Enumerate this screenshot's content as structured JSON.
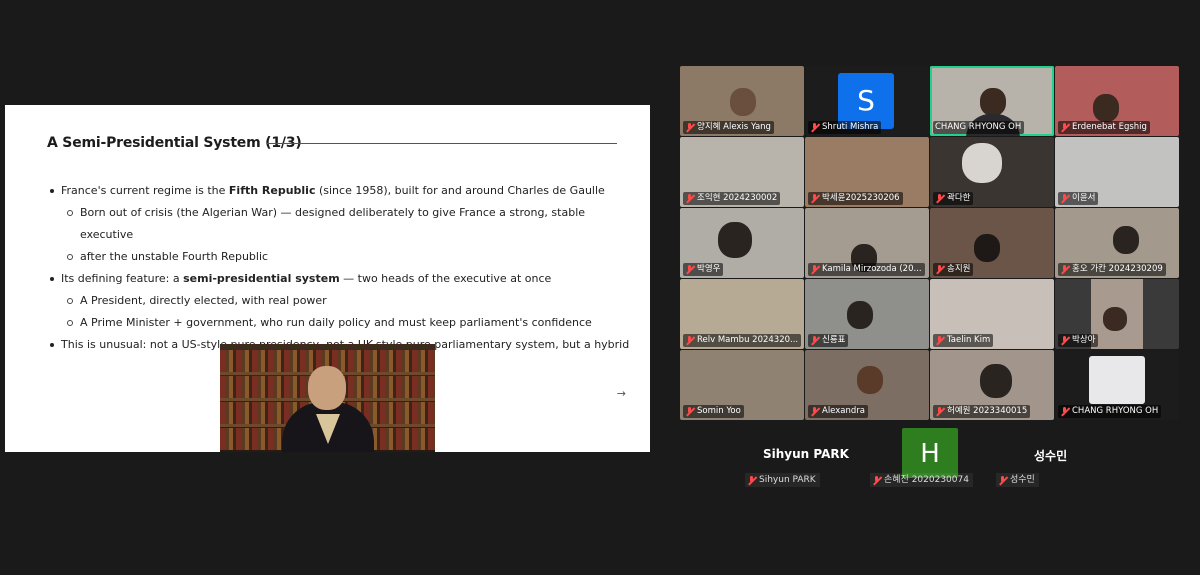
{
  "slide": {
    "title": "A Semi-Presidential System (1/3)",
    "bullets": [
      {
        "level": 1,
        "pre": "France's current regime is the ",
        "bold": "Fifth Republic",
        "post": " (since 1958), built for and around Charles de Gaulle"
      },
      {
        "level": 2,
        "text": "Born out of crisis (the Algerian War) — designed deliberately to give France a strong, stable executive"
      },
      {
        "level": 2,
        "text": "after the unstable Fourth Republic",
        "continuation": true
      },
      {
        "level": 1,
        "pre": "Its defining feature: a ",
        "bold": "semi-presidential system",
        "post": " — two heads of the executive at once"
      },
      {
        "level": 2,
        "text": "A President, directly elected, with real power"
      },
      {
        "level": 2,
        "text": "A Prime Minister + government, who run daily policy and must keep parliament's confidence"
      },
      {
        "level": 1,
        "text": "This is unusual: not a US-style pure presidency, not a UK-style pure parliamentary system, but a hybrid"
      }
    ],
    "arrow": "→"
  },
  "gallery": {
    "tiles": [
      {
        "label": "양지혜 Alexis Yang",
        "bg": "#8c7a66"
      },
      {
        "label": "Shruti Mishra",
        "bg": "#1c1c1c",
        "initial": "S"
      },
      {
        "label": "CHANG RHYONG OH",
        "bg": "#b7b2aa",
        "active": true
      },
      {
        "label": "Erdenebat Egshig",
        "bg": "#b25c5c"
      },
      {
        "label": "조익현 2024230002",
        "bg": "#b9b4ab"
      },
      {
        "label": "박세윤2025230206",
        "bg": "#9a7b63"
      },
      {
        "label": "곽다한",
        "bg": "#3a3531"
      },
      {
        "label": "이윤서",
        "bg": "#c2c2c0"
      },
      {
        "label": "박영우",
        "bg": "#b0aca6"
      },
      {
        "label": "Kamila Mirzozoda (20...",
        "bg": "#a49c90"
      },
      {
        "label": "송지원",
        "bg": "#6b5548"
      },
      {
        "label": "홍오 가칸 2024230209",
        "bg": "#a3998d"
      },
      {
        "label": "Relv Mambu 2024320...",
        "bg": "#b7aa94"
      },
      {
        "label": "신룡표",
        "bg": "#8f8f8b"
      },
      {
        "label": "Taelin Kim",
        "bg": "#c8c0b8"
      },
      {
        "label": "박상아",
        "bg": "#3a3a3a"
      },
      {
        "label": "Somin Yoo",
        "bg": "#8f8273"
      },
      {
        "label": "Alexandra",
        "bg": "#7c6e62"
      },
      {
        "label": "허예원 2023340015",
        "bg": "#a2958b"
      },
      {
        "label": "CHANG RHYONG OH",
        "bg": "#1c1c1c"
      }
    ]
  },
  "bottom": {
    "p1": {
      "name": "Sihyun PARK",
      "label": "Sihyun PARK"
    },
    "p2": {
      "initial": "H",
      "label": "손혜진 2020230074"
    },
    "p3": {
      "name": "성수민",
      "label": "성수민"
    }
  }
}
